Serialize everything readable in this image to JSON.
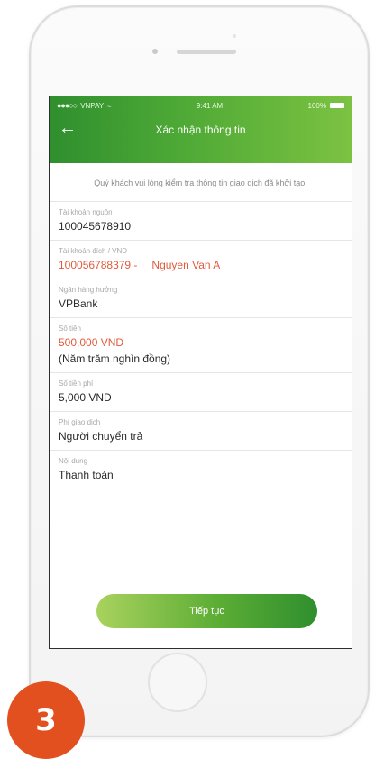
{
  "status_bar": {
    "carrier": "VNPAY",
    "time": "9:41 AM",
    "battery": "100%"
  },
  "header": {
    "title": "Xác nhận thông tin"
  },
  "notice": "Quý khách vui lòng kiểm tra thông tin giao dịch đã khởi tạo.",
  "fields": {
    "source_account": {
      "label": "Tài khoản nguồn",
      "value": "100045678910"
    },
    "destination_account": {
      "label": "Tài khoản đích / VND",
      "number": "100056788379 -",
      "name": "Nguyen Van A"
    },
    "bank": {
      "label": "Ngân hàng hưởng",
      "value": "VPBank"
    },
    "amount": {
      "label": "Số tiền",
      "value": "500,000 VND",
      "in_words": "(Năm trăm nghìn đồng)"
    },
    "fee": {
      "label": "Số tiền phí",
      "value": "5,000 VND"
    },
    "fee_payer": {
      "label": "Phí giao dịch",
      "value": "Người chuyển trả"
    },
    "content": {
      "label": "Nội dung",
      "value": "Thanh toán"
    }
  },
  "actions": {
    "continue_label": "Tiếp tục"
  },
  "step_badge": "3",
  "colors": {
    "header_green": "#4faa36",
    "highlight_red": "#e05a3c",
    "badge_orange": "#e2501f"
  }
}
